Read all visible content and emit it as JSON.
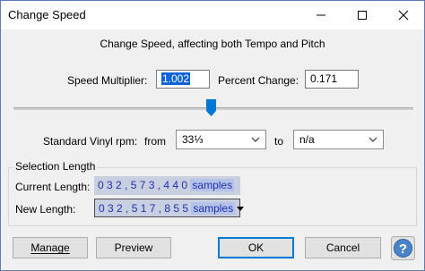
{
  "window": {
    "title": "Change Speed"
  },
  "titlebar": {
    "min_icon": "minimize-icon",
    "max_icon": "maximize-icon",
    "close_icon": "close-icon"
  },
  "heading": "Change Speed, affecting both Tempo and Pitch",
  "speed": {
    "multiplier_label": "Speed Multiplier:",
    "multiplier_value": "1.002",
    "percent_label": "Percent Change:",
    "percent_value": "0.171",
    "slider_value_percent": 0.171
  },
  "vinyl": {
    "label": "Standard Vinyl rpm:",
    "from_label": "from",
    "from_value": "33⅓",
    "to_label": "to",
    "to_value": "n/a"
  },
  "selection": {
    "group_title": "Selection Length",
    "current_label": "Current Length:",
    "current_digits": "0 3 2 , 5 7 3 , 4 4 0",
    "current_units": "samples",
    "new_label": "New Length:",
    "new_digits": "0 3 2 , 5 1 7 , 8 5 5",
    "new_units": "samples"
  },
  "buttons": {
    "manage": "Manage",
    "preview": "Preview",
    "ok": "OK",
    "cancel": "Cancel",
    "help_icon": "help-icon"
  },
  "colors": {
    "accent": "#0078d7",
    "time_text": "#1f2fb8",
    "help_blue": "#4a84c8"
  }
}
